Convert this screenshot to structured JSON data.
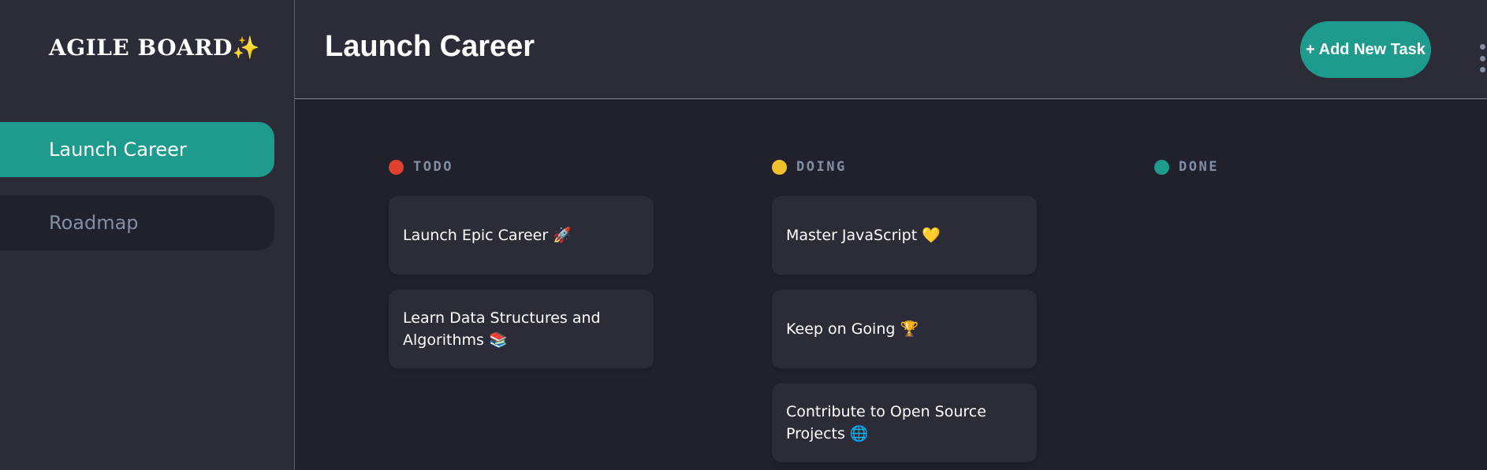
{
  "sidebar": {
    "logo": "AGILE BOARD",
    "logo_sparkle": "✨",
    "boards": [
      {
        "label": "Launch Career",
        "active": true
      },
      {
        "label": "Roadmap",
        "active": false
      }
    ]
  },
  "header": {
    "title": "Launch Career",
    "add_button": "+ Add New Task",
    "menu_icon": "kebab-vertical-icon"
  },
  "columns": [
    {
      "name": "TODO",
      "color": "#e0412e",
      "tasks": [
        {
          "title": "Launch Epic Career",
          "emoji": "🚀"
        },
        {
          "title": "Learn Data Structures and Algorithms",
          "emoji": "📚"
        }
      ]
    },
    {
      "name": "DOING",
      "color": "#efc22d",
      "tasks": [
        {
          "title": "Master JavaScript",
          "emoji": "💛"
        },
        {
          "title": "Keep on Going",
          "emoji": "🏆"
        },
        {
          "title": "Contribute to Open Source Projects",
          "emoji": "🌐"
        }
      ]
    },
    {
      "name": "DONE",
      "color": "#1f9b8e",
      "tasks": []
    }
  ],
  "colors": {
    "accent": "#1f9b8e",
    "background": "#21212d",
    "panel": "#2b2c37",
    "muted_text": "#828fa3"
  }
}
